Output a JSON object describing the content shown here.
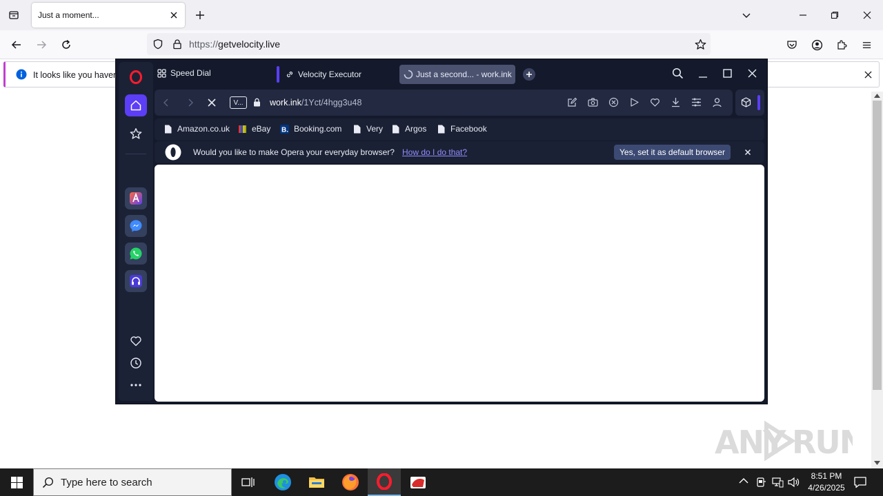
{
  "firefox": {
    "tab_title": "Just a moment...",
    "url_proto": "https://",
    "url_host": "getvelocity.live",
    "notification_text": "It looks like you haven't"
  },
  "opera": {
    "speed_dial_label": "Speed Dial",
    "tabs": [
      {
        "label": "Velocity Executor"
      },
      {
        "label": "Just a second... - work.ink"
      }
    ],
    "address": {
      "site_badge": "V...",
      "host": "work.ink",
      "path": "/1Yct/4hgg3u48"
    },
    "bookmarks": [
      {
        "label": "Amazon.co.uk",
        "icon": "page-icon"
      },
      {
        "label": "eBay",
        "icon": "ebay-icon"
      },
      {
        "label": "Booking.com",
        "icon": "booking-icon"
      },
      {
        "label": "Very",
        "icon": "page-icon"
      },
      {
        "label": "Argos",
        "icon": "page-icon"
      },
      {
        "label": "Facebook",
        "icon": "page-icon"
      }
    ],
    "banner": {
      "question": "Would you like to make Opera your everyday browser?",
      "link": "How do I do that?",
      "button": "Yes, set it as default browser"
    },
    "colors": {
      "accent": "#5b3ef5",
      "window_bg": "#141a2b"
    }
  },
  "taskbar": {
    "search_placeholder": "Type here to search",
    "time": "8:51 PM",
    "date": "4/26/2025"
  },
  "watermark": "ANY RUN"
}
